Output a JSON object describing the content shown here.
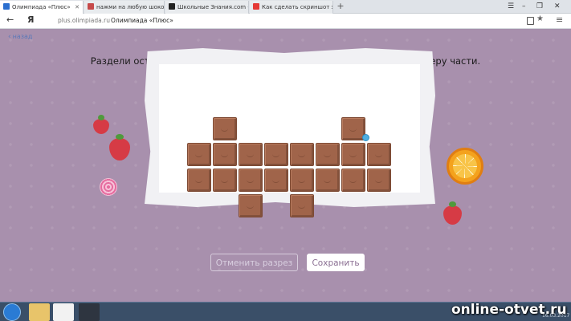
{
  "browser": {
    "tabs": [
      {
        "label": "Олимпиада «Плюс»",
        "favicon_color": "#2b6fcf",
        "active": true
      },
      {
        "label": "нажми на любую шоколадк",
        "favicon_color": "#c64a4a",
        "active": false
      },
      {
        "label": "Школьные Знания.com - P",
        "favicon_color": "#222222",
        "active": false
      },
      {
        "label": "Как сделать скриншот экр",
        "favicon_color": "#e53935",
        "active": false
      }
    ],
    "new_tab_glyph": "+",
    "address": {
      "domain": "plus.olimpiada.ru",
      "title": "Олимпиада «Плюс»"
    },
    "back_glyph": "←",
    "brand_glyph": "Я",
    "star_glyph": "★",
    "menu_glyph": "≡",
    "window_controls": [
      "☰",
      "–",
      "❐",
      "✕"
    ]
  },
  "page": {
    "back_link": "назад",
    "task_text": "Раздели остаток шоколадки на четыре одинаковые по форме и размеру части.",
    "chocolate": {
      "color": "#a0644a",
      "layout": [
        [
          0,
          1,
          0,
          0,
          0,
          0,
          1,
          0
        ],
        [
          1,
          1,
          1,
          1,
          1,
          1,
          1,
          1
        ],
        [
          1,
          1,
          1,
          1,
          1,
          1,
          1,
          1
        ],
        [
          0,
          0,
          1,
          0,
          1,
          0,
          0,
          0
        ]
      ]
    },
    "buttons": {
      "cancel_cut": "Отменить разрез",
      "save": "Сохранить"
    }
  },
  "taskbar": {
    "watermark": "online-otvet.ru",
    "date": "16.03.2017"
  }
}
